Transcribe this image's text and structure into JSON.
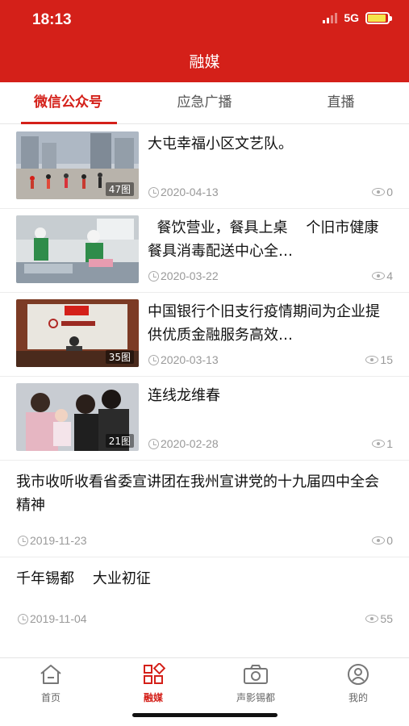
{
  "status_bar": {
    "time": "18:13",
    "network": "5G"
  },
  "header": {
    "title": "融媒"
  },
  "tabs": [
    {
      "label": "微信公众号",
      "active": true
    },
    {
      "label": "应急广播",
      "active": false
    },
    {
      "label": "直播",
      "active": false
    }
  ],
  "articles": [
    {
      "title": "大屯幸福小区文艺队。",
      "date": "2020-04-13",
      "views": "0",
      "image_count": "47图"
    },
    {
      "title": "  餐饮营业，餐具上桌    个旧市健康餐具消毒配送中心全…",
      "date": "2020-03-22",
      "views": "4"
    },
    {
      "title": "中国银行个旧支行疫情期间为企业提供优质金融服务高效…",
      "date": "2020-03-13",
      "views": "15",
      "image_count": "35图"
    },
    {
      "title": "连线龙维春",
      "date": "2020-02-28",
      "views": "1",
      "image_count": "21图"
    },
    {
      "title": "我市收听收看省委宣讲团在我州宣讲党的十九届四中全会精神",
      "date": "2019-11-23",
      "views": "0"
    },
    {
      "title": "千年锡都    大业初征",
      "date": "2019-11-04",
      "views": "55"
    }
  ],
  "bottom_nav": [
    {
      "label": "首页",
      "icon": "home-icon",
      "active": false
    },
    {
      "label": "融媒",
      "icon": "grid-icon",
      "active": true
    },
    {
      "label": "声影锡都",
      "icon": "camera-icon",
      "active": false
    },
    {
      "label": "我的",
      "icon": "user-icon",
      "active": false
    }
  ],
  "colors": {
    "brand": "#d42019",
    "meta": "#999999"
  }
}
